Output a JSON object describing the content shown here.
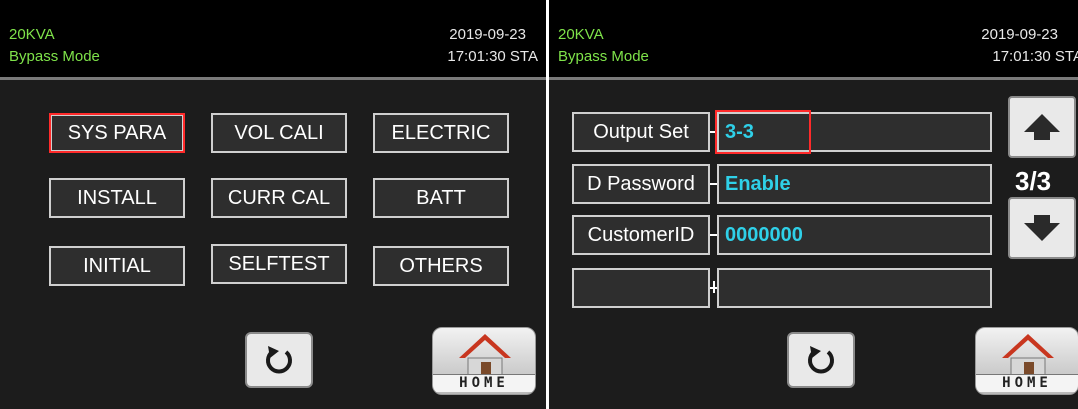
{
  "left_screen": {
    "header": {
      "model": "20KVA",
      "mode": "Bypass Mode",
      "date": "2019-09-23",
      "time": "17:01:30 STA"
    },
    "menu": [
      {
        "label": "SYS PARA"
      },
      {
        "label": "VOL CALI"
      },
      {
        "label": "ELECTRIC"
      },
      {
        "label": "INSTALL"
      },
      {
        "label": "CURR CAL"
      },
      {
        "label": "BATT"
      },
      {
        "label": "INITIAL"
      },
      {
        "label": "SELFTEST"
      },
      {
        "label": "OTHERS"
      }
    ],
    "selected_item": "SYS PARA",
    "back_icon": "refresh-arrow-icon",
    "home_icon": "house-icon",
    "home_label": "HOME"
  },
  "right_screen": {
    "header": {
      "model": "20KVA",
      "mode": "Bypass Mode",
      "date": "2019-09-23",
      "time": "17:01:30 STA"
    },
    "params": [
      {
        "label": "Output Set",
        "value": "3-3"
      },
      {
        "label": "D Password",
        "value": "Enable"
      },
      {
        "label": "CustomerID",
        "value": "0000000"
      },
      {
        "label": "",
        "value": ""
      }
    ],
    "page_indicator": "3/3",
    "up_icon": "arrow-up-icon",
    "down_icon": "arrow-down-icon",
    "back_icon": "refresh-arrow-icon",
    "home_icon": "house-icon",
    "home_label": "HOME"
  },
  "colors": {
    "header_text_green": "#7fe34a",
    "value_cyan": "#2fd0e8",
    "highlight_red": "#ff2a2a",
    "screen_bg": "#1c1c1c"
  }
}
